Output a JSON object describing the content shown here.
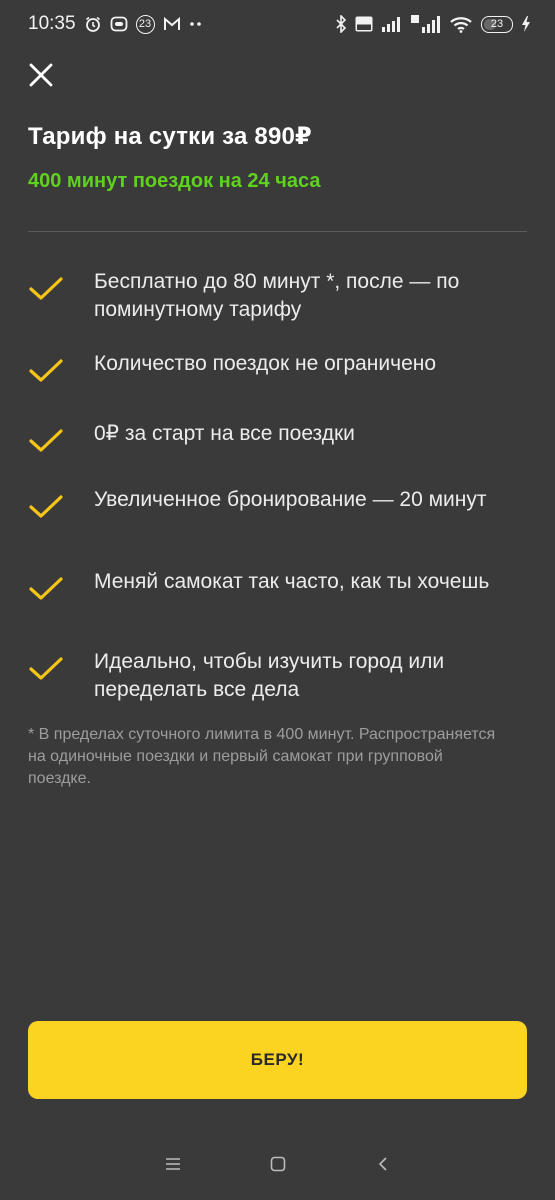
{
  "status_bar": {
    "time": "10:35",
    "notification_count": "23",
    "battery_level": "23",
    "icons": [
      "alarm-icon",
      "app-icon",
      "badge-icon",
      "gmail-icon",
      "more-dots-icon",
      "bluetooth-icon",
      "volte-icon",
      "signal-icon",
      "4g-signal-icon",
      "wifi-icon",
      "battery-icon",
      "charging-icon"
    ]
  },
  "header": {
    "title": "Тариф на сутки за 890₽",
    "subtitle": "400 минут поездок на 24 часа"
  },
  "features": [
    {
      "text": "Бесплатно до 80 минут *, после — по поминутному тарифу",
      "icon": "check-icon"
    },
    {
      "text": "Количество поездок не ограничено",
      "icon": "check-icon"
    },
    {
      "text": "0₽ за старт на все поездки",
      "icon": "check-icon"
    },
    {
      "text": "Увеличенное бронирование — 20 минут",
      "icon": "check-icon"
    },
    {
      "text": "Меняй самокат так часто, как ты хочешь",
      "icon": "check-icon"
    },
    {
      "text": "Идеально, чтобы изучить город или переделать все дела",
      "icon": "check-icon"
    }
  ],
  "footnote": "* В пределах суточного лимита в 400 минут. Распространяется на одиночные поездки и первый самокат при групповой поездке.",
  "cta": {
    "label": "БЕРУ!"
  },
  "colors": {
    "background": "#3a3a3a",
    "accent_green": "#5fd21e",
    "check_yellow": "#f5c518",
    "button_yellow": "#fbd321",
    "footnote_gray": "#9d9d9d"
  },
  "nav_bar": {
    "icons": [
      "menu-icon",
      "home-icon",
      "back-icon"
    ]
  }
}
